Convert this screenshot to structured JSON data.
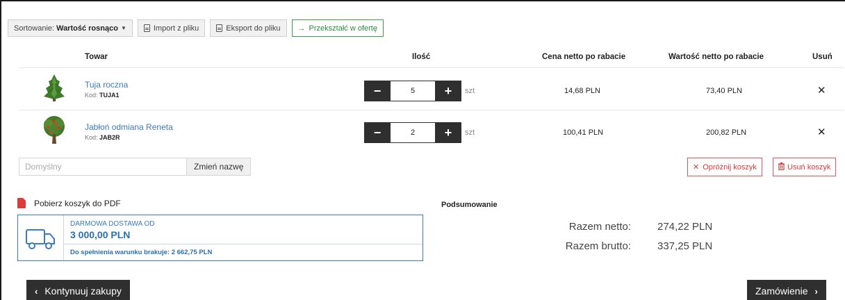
{
  "toolbar": {
    "sort_prefix": "Sortowanie:",
    "sort_value": "Wartość rosnąco",
    "import_label": "Import z pliku",
    "export_label": "Eksport do pliku",
    "convert_label": "Przekształć w ofertę"
  },
  "table": {
    "headers": {
      "product": "Towar",
      "quantity": "Ilość",
      "net_price": "Cena netto po rabacie",
      "net_value": "Wartość netto po rabacie",
      "remove": "Usuń"
    },
    "rows": [
      {
        "name": "Tuja roczna",
        "code_prefix": "Kod:",
        "code": "TUJA1",
        "quantity": "5",
        "unit": "szt",
        "net_price": "14,68 PLN",
        "net_value": "73,40 PLN"
      },
      {
        "name": "Jabłoń odmiana Reneta",
        "code_prefix": "Kod:",
        "code": "JAB2R",
        "quantity": "2",
        "unit": "szt",
        "net_price": "100,41 PLN",
        "net_value": "200,82 PLN"
      }
    ]
  },
  "cart_name": {
    "value": "Domyślny",
    "rename_label": "Zmień nazwę"
  },
  "cart_actions": {
    "clear_label": "Opróżnij koszyk",
    "delete_label": "Usuń koszyk"
  },
  "pdf": {
    "label": "Pobierz koszyk do PDF"
  },
  "shipping": {
    "line1": "DARMOWA DOSTAWA OD",
    "amount": "3 000,00 PLN",
    "missing": "Do spełnienia warunku brakuje: 2 662,75 PLN"
  },
  "summary": {
    "heading": "Podsumowanie",
    "net_label": "Razem netto:",
    "net_value": "274,22 PLN",
    "gross_label": "Razem brutto:",
    "gross_value": "337,25 PLN"
  },
  "nav": {
    "continue_label": "Kontynuuj zakupy",
    "order_label": "Zamówienie"
  },
  "colors": {
    "link": "#3a7bbf",
    "green": "#3aa04a",
    "red": "#d93a3a",
    "dark": "#2f2f2f"
  }
}
